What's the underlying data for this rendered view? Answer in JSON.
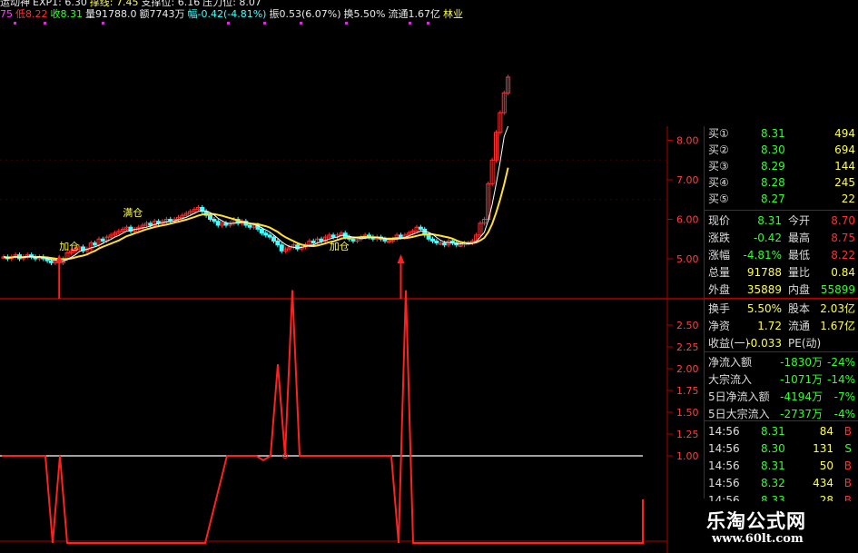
{
  "header": {
    "row1": [
      {
        "text": "运动神",
        "color": "white"
      },
      {
        "text": "EXP1: 6.30",
        "color": "white"
      },
      {
        "text": "撑线: 7.45",
        "color": "yellow"
      },
      {
        "text": "支撑位: 6.16",
        "color": "white"
      },
      {
        "text": "压力位: 8.07",
        "color": "white"
      }
    ],
    "row2": [
      {
        "text": "75",
        "color": "magenta"
      },
      {
        "text": "低8.22",
        "color": "red"
      },
      {
        "text": "收8.31",
        "color": "green"
      },
      {
        "text": "量91788.0",
        "color": "white"
      },
      {
        "text": "额7743万",
        "color": "white"
      },
      {
        "text": "幅-0.42(-4.81%)",
        "color": "cyan"
      },
      {
        "text": "振0.53(6.07%)",
        "color": "white"
      },
      {
        "text": "换5.50%",
        "color": "white"
      },
      {
        "text": "流通1.67亿",
        "color": "white"
      },
      {
        "text": "林业",
        "color": "yellow"
      }
    ]
  },
  "quote_panel": {
    "orders": [
      {
        "label": "买①",
        "price": "8.31",
        "vol": "494"
      },
      {
        "label": "买②",
        "price": "8.30",
        "vol": "694"
      },
      {
        "label": "买③",
        "price": "8.29",
        "vol": "144"
      },
      {
        "label": "买④",
        "price": "8.28",
        "vol": "245"
      },
      {
        "label": "买⑤",
        "price": "8.27",
        "vol": "22"
      }
    ],
    "stats": [
      {
        "l1": "现价",
        "v1": "8.31",
        "l2": "今开",
        "v2": "8.70"
      },
      {
        "l1": "涨跌",
        "v1": "-0.42",
        "l2": "最高",
        "v2": "8.75"
      },
      {
        "l1": "涨幅",
        "v1": "-4.81%",
        "l2": "最低",
        "v2": "8.22"
      },
      {
        "l1": "总量",
        "v1": "91788",
        "l2": "量比",
        "v2": "0.84"
      },
      {
        "l1": "外盘",
        "v1": "35889",
        "l2": "内盘",
        "v2": "55899"
      }
    ],
    "info": [
      {
        "l1": "换手",
        "v1": "5.50%",
        "l2": "股本",
        "v2": "2.03亿"
      },
      {
        "l1": "净资",
        "v1": "1.72",
        "l2": "流通",
        "v2": "1.67亿"
      },
      {
        "l1": "收益(一)",
        "v1": "-0.033",
        "l2": "PE(动)",
        "v2": ""
      }
    ],
    "flows": [
      {
        "label": "净流入额",
        "val": "-1830万",
        "pct": "-24%"
      },
      {
        "label": "大宗流入",
        "val": "-1071万",
        "pct": "-14%"
      },
      {
        "label": "5日净流入额",
        "val": "-4194万",
        "pct": "-7%"
      },
      {
        "label": "5日大宗流入",
        "val": "-2737万",
        "pct": "-4%"
      }
    ],
    "ticks": [
      {
        "time": "14:56",
        "price": "8.31",
        "vol": "84",
        "side": "B"
      },
      {
        "time": "14:56",
        "price": "8.30",
        "vol": "131",
        "side": "S"
      },
      {
        "time": "14:56",
        "price": "8.31",
        "vol": "50",
        "side": "B"
      },
      {
        "time": "14:56",
        "price": "8.32",
        "vol": "434",
        "side": "B"
      },
      {
        "time": "14:56",
        "price": "8.33",
        "vol": "28",
        "side": "B"
      }
    ]
  },
  "watermark": {
    "line1": "乐淘公式网",
    "line2": "www.60lt.com"
  },
  "colors": {
    "up": "#ff3030",
    "down": "#40ffff",
    "ma": "#ffe030",
    "ma2": "#ffffff",
    "signal": "#ff2020",
    "axis": "#b00000",
    "ref_line": "#ffffff"
  },
  "chart_data": [
    {
      "type": "candlestick",
      "yticks": [
        5.0,
        6.0,
        7.0,
        8.0
      ],
      "ylim": [
        4.7,
        8.3
      ],
      "annotations": [
        {
          "text": "满仓",
          "index": 30
        },
        {
          "text": "加仓",
          "index": 82
        },
        {
          "text": "加仓",
          "index": 14
        }
      ],
      "buy_arrows": [
        14,
        100
      ],
      "closes": [
        5.05,
        5.0,
        5.05,
        5.1,
        5.0,
        5.05,
        5.1,
        5.05,
        5.0,
        5.05,
        5.0,
        4.95,
        4.9,
        4.95,
        4.9,
        5.0,
        5.15,
        5.2,
        5.25,
        5.3,
        5.2,
        5.25,
        5.4,
        5.35,
        5.5,
        5.45,
        5.55,
        5.6,
        5.65,
        5.7,
        5.75,
        5.8,
        5.7,
        5.75,
        5.8,
        5.85,
        5.9,
        5.85,
        5.95,
        5.9,
        5.95,
        6.0,
        5.95,
        6.0,
        6.05,
        6.1,
        6.15,
        6.2,
        6.25,
        6.3,
        6.2,
        6.1,
        6.0,
        5.95,
        5.85,
        5.9,
        5.85,
        5.9,
        6.0,
        5.9,
        5.95,
        5.85,
        5.8,
        5.85,
        5.75,
        5.65,
        5.6,
        5.55,
        5.45,
        5.35,
        5.2,
        5.25,
        5.3,
        5.35,
        5.25,
        5.3,
        5.35,
        5.45,
        5.4,
        5.5,
        5.45,
        5.55,
        5.6,
        5.55,
        5.6,
        5.65,
        5.55,
        5.5,
        5.45,
        5.5,
        5.55,
        5.6,
        5.55,
        5.5,
        5.55,
        5.5,
        5.45,
        5.45,
        5.5,
        5.6,
        5.55,
        5.6,
        5.65,
        5.7,
        5.8,
        5.75,
        5.6,
        5.5,
        5.45,
        5.4,
        5.4,
        5.35,
        5.45,
        5.4,
        5.35,
        5.35,
        5.4,
        5.4,
        5.45,
        5.6,
        5.9,
        6.0,
        6.9,
        7.5,
        8.2,
        8.7,
        9.2,
        9.6
      ]
    },
    {
      "type": "line",
      "yticks": [
        1.0,
        1.25,
        1.5,
        1.75,
        2.0,
        2.25,
        2.5
      ],
      "ylim": [
        0.0,
        2.9
      ],
      "ref_line": 1.0,
      "spikes": [
        {
          "index": 14,
          "value": -0.0,
          "kind": "dip"
        },
        {
          "index": 80,
          "value": 2.9,
          "kind": "peak"
        },
        {
          "index": 100,
          "value": 2.9,
          "kind": "peak"
        }
      ],
      "x": [
        0,
        12,
        14,
        16,
        18,
        20,
        56,
        62,
        64,
        70,
        72,
        74,
        76,
        78,
        80,
        82,
        84,
        96,
        98,
        100,
        102,
        150,
        158,
        160
      ],
      "values": [
        1.0,
        1.0,
        0.0,
        1.0,
        0.0,
        0.0,
        0.0,
        1.0,
        1.0,
        1.0,
        0.95,
        1.0,
        2.05,
        1.0,
        2.9,
        1.0,
        1.0,
        1.0,
        0.0,
        2.9,
        0.0,
        0.0,
        0.0,
        0.5
      ]
    }
  ]
}
